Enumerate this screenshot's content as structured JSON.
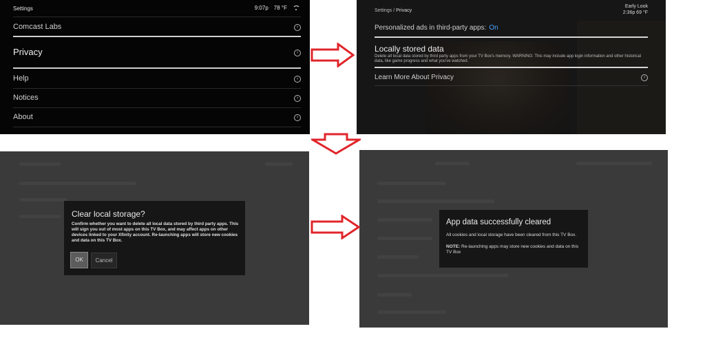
{
  "panel1": {
    "title": "Settings",
    "time": "9:07p",
    "temp": "78 °F",
    "items": [
      {
        "label": "Comcast Labs"
      },
      {
        "label": "Privacy"
      },
      {
        "label": "Help"
      },
      {
        "label": "Notices"
      },
      {
        "label": "About"
      }
    ]
  },
  "panel2": {
    "breadcrumb_parent": "Settings",
    "breadcrumb_current": "Privacy",
    "badge": "Early Look",
    "time_temp": "2:36p  69 °F",
    "ads_label": "Personalized ads in third-party apps:",
    "ads_value": "On",
    "local_title": "Locally stored data",
    "local_desc": "Delete all local data stored by third party apps from your TV Box's memory. WARNING: This may include app login information and other historical data, like game progress and what you've watched.",
    "learn_more": "Learn More About Privacy"
  },
  "panel3": {
    "dialog_title": "Clear local storage?",
    "dialog_body": "Confirm whether you want to delete all local data stored by third party apps. This will sign you out of most apps on this TV Box, and may affect apps on other devices linked to your Xfinity account. Re-launching apps will store new cookies and data on this TV Box.",
    "ok_label": "OK",
    "cancel_label": "Cancel"
  },
  "panel4": {
    "dialog_title": "App data successfully cleared",
    "line1": "All cookies and local storage have been cleared from this TV Box.",
    "note_label": "NOTE:",
    "note_text": " Re-launching apps may store new cookies and data on this TV Box"
  },
  "colors": {
    "arrow": "#e0252b",
    "accent_on": "#4aa3ff"
  }
}
